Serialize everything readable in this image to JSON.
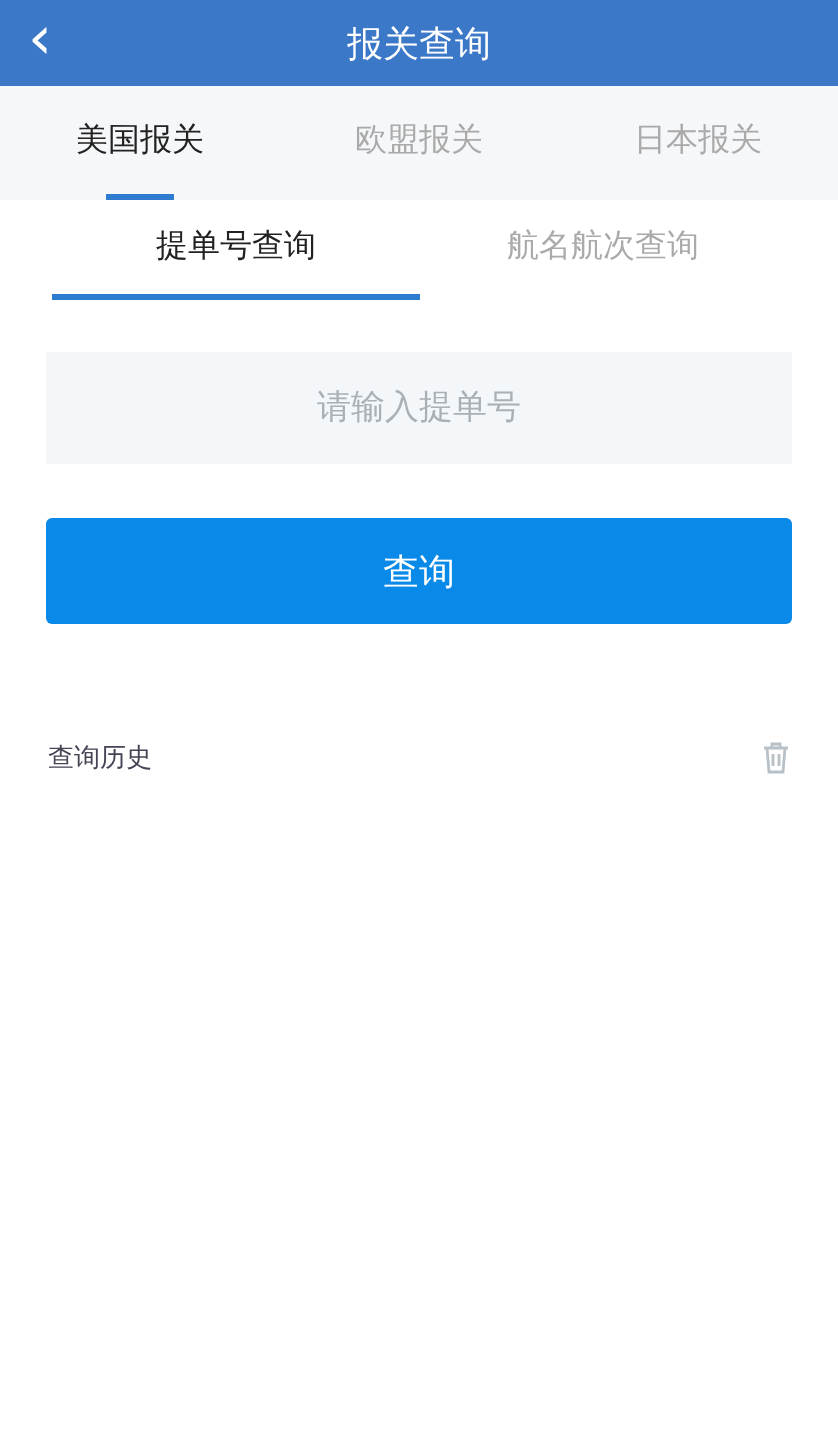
{
  "header": {
    "back": "‹",
    "title": "报关查询"
  },
  "tabs": [
    {
      "label": "美国报关",
      "selected": true
    },
    {
      "label": "欧盟报关",
      "selected": false
    },
    {
      "label": "日本报关",
      "selected": false
    }
  ],
  "subtabs": [
    {
      "label": "提单号查询",
      "selected": true
    },
    {
      "label": "航名航次查询",
      "selected": false
    }
  ],
  "search": {
    "placeholder": "请输入提单号"
  },
  "button": "查询",
  "history": {
    "title": "查询历史"
  }
}
